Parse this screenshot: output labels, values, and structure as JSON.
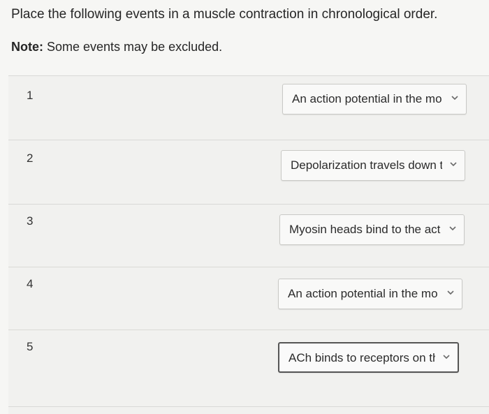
{
  "question": {
    "prompt": "Place the following events in a muscle contraction in chronological order.",
    "note_label": "Note:",
    "note_text": " Some events may be excluded."
  },
  "rows": [
    {
      "number": "1",
      "selected": "An action potential in the mo"
    },
    {
      "number": "2",
      "selected": "Depolarization travels down t"
    },
    {
      "number": "3",
      "selected": "Myosin heads bind to the act"
    },
    {
      "number": "4",
      "selected": "An action potential in the mo"
    },
    {
      "number": "5",
      "selected": "ACh binds to receptors on the"
    }
  ],
  "icons": {
    "dropdown": "chevron-down-icon"
  }
}
